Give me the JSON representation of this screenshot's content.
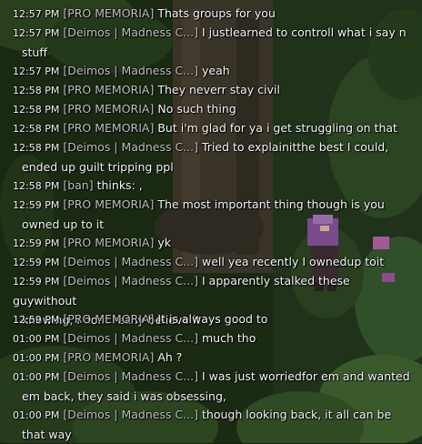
{
  "chat": {
    "lines": [
      {
        "time": "12:57 PM",
        "sender": "[PRO MEMORIA]",
        "text": "Thats groups for you",
        "cont": ""
      },
      {
        "time": "12:57 PM",
        "sender": "[Deimos | Madness C...]",
        "text": "I justlearned to controll what i say n",
        "cont": "stuff"
      },
      {
        "time": "12:57 PM",
        "sender": "[Deimos | Madness C...]",
        "text": "yeah",
        "cont": ""
      },
      {
        "time": "12:58 PM",
        "sender": "[PRO MEMORIA]",
        "text": "They neverr stay civil",
        "cont": ""
      },
      {
        "time": "12:58 PM",
        "sender": "[PRO MEMORIA]",
        "text": "No such thing",
        "cont": ""
      },
      {
        "time": "12:58 PM",
        "sender": "[PRO MEMORIA]",
        "text": "But i'm glad for ya i get struggling on that",
        "cont": ""
      },
      {
        "time": "12:58 PM",
        "sender": "[Deimos | Madness C...]",
        "text": "Tried to explainitthe best I could,",
        "cont": "ended up guilt tripping ppl"
      },
      {
        "time": "12:58 PM",
        "sender": "[ban]",
        "text": "thinks: ,",
        "cont": ""
      },
      {
        "time": "12:59 PM",
        "sender": "[PRO MEMORIA]",
        "text": "The most important thing though is you",
        "cont": "owned up to it"
      },
      {
        "time": "12:59 PM",
        "sender": "[PRO MEMORIA]",
        "text": "yk",
        "cont": ""
      },
      {
        "time": "12:59 PM",
        "sender": "[Deimos | Madness C...]",
        "text": "well yea recently I ownedup toit",
        "cont": ""
      },
      {
        "time": "12:59 PM",
        "sender": "[Deimos | Madness C...]",
        "text": "I apparently stalked these guywithout",
        "cont": "knowing, i dont really believe it"
      },
      {
        "time": "12:59 PM",
        "sender": "[PRO MEMORIA]",
        "text": "It is always good to",
        "cont": ""
      },
      {
        "time": "01:00 PM",
        "sender": "[Deimos | Madness C...]",
        "text": "much tho",
        "cont": ""
      },
      {
        "time": "01:00 PM",
        "sender": "[PRO MEMORIA]",
        "text": "Ah ?",
        "cont": ""
      },
      {
        "time": "01:00 PM",
        "sender": "[Deimos | Madness C...]",
        "text": "I was just worriedfor em and wanted",
        "cont": "em back, they said i was obsessing,"
      },
      {
        "time": "01:00 PM",
        "sender": "[Deimos | Madness C...]",
        "text": "though looking back, it all can be",
        "cont": "that way"
      }
    ]
  }
}
